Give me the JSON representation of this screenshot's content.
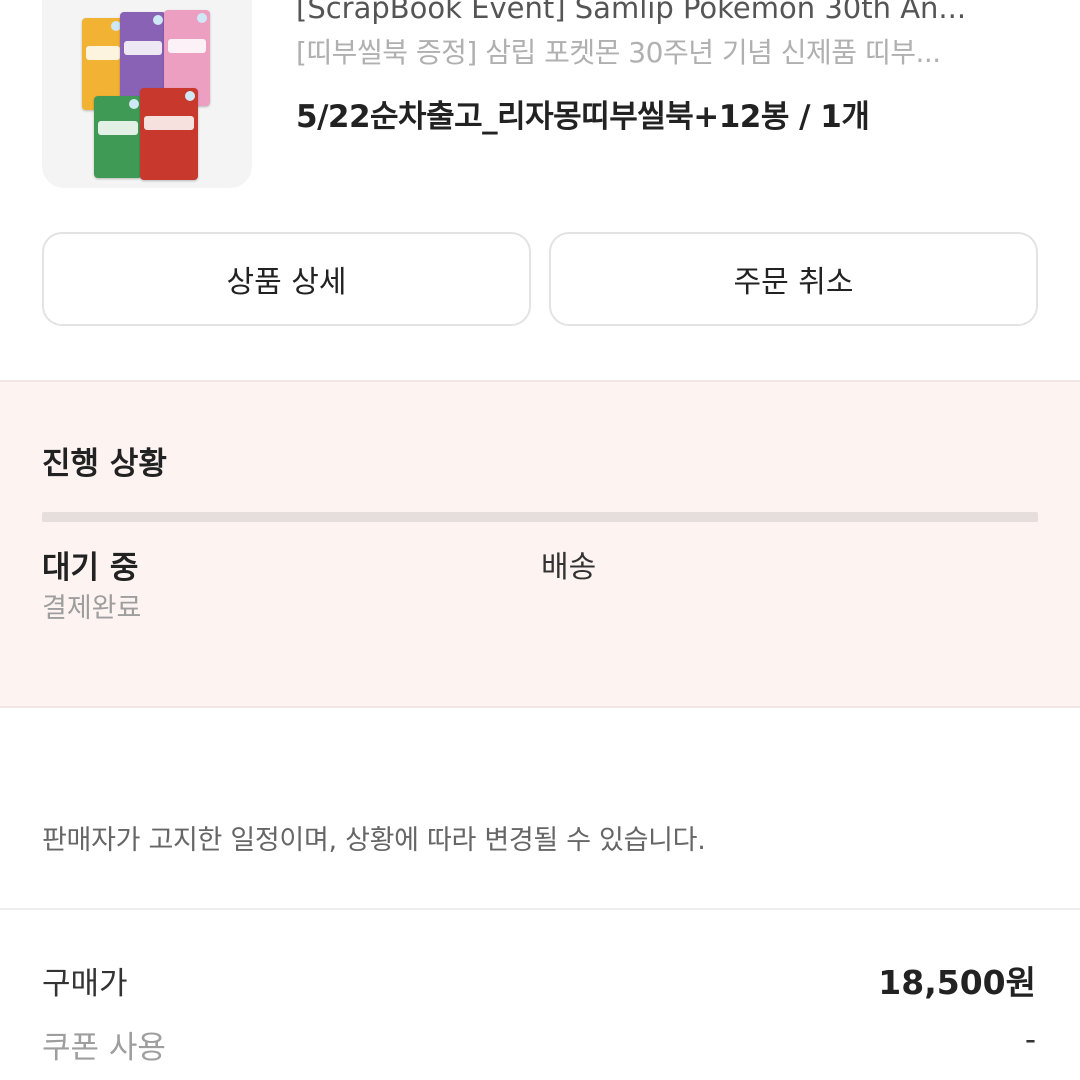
{
  "product": {
    "title": "[ScrapBook Event] Samlip Pokemon 30th An...",
    "subtitle": "[띠부씰북 증정] 삼립 포켓몬 30주년 기념 신제품 띠부...",
    "option": "5/22순차출고_리자몽띠부씰북+12봉 / 1개",
    "image_icon": "product-image"
  },
  "buttons": {
    "detail": "상품 상세",
    "cancel": "주문 취소"
  },
  "progress": {
    "title": "진행 상황",
    "current_step": "대기 중",
    "current_sub": "결제완료",
    "next_step": "배송"
  },
  "notice": "판매자가 고지한 일정이며, 상황에 따라 변경될 수 있습니다.",
  "payment": {
    "price_label": "구매가",
    "price_value": "18,500원",
    "coupon_label": "쿠폰 사용",
    "coupon_value": "-"
  },
  "colors": {
    "progress_bg": "#fdf4f2",
    "track": "#e6dedc",
    "muted_text": "#9e9e9e"
  }
}
